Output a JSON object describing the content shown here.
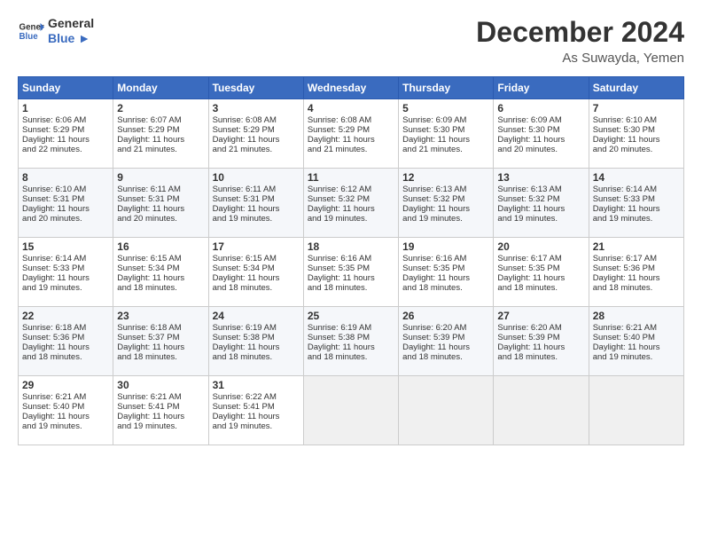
{
  "header": {
    "logo_line1": "General",
    "logo_line2": "Blue",
    "month": "December 2024",
    "location": "As Suwayda, Yemen"
  },
  "days_of_week": [
    "Sunday",
    "Monday",
    "Tuesday",
    "Wednesday",
    "Thursday",
    "Friday",
    "Saturday"
  ],
  "weeks": [
    [
      {
        "day": "1",
        "lines": [
          "Sunrise: 6:06 AM",
          "Sunset: 5:29 PM",
          "Daylight: 11 hours",
          "and 22 minutes."
        ]
      },
      {
        "day": "2",
        "lines": [
          "Sunrise: 6:07 AM",
          "Sunset: 5:29 PM",
          "Daylight: 11 hours",
          "and 21 minutes."
        ]
      },
      {
        "day": "3",
        "lines": [
          "Sunrise: 6:08 AM",
          "Sunset: 5:29 PM",
          "Daylight: 11 hours",
          "and 21 minutes."
        ]
      },
      {
        "day": "4",
        "lines": [
          "Sunrise: 6:08 AM",
          "Sunset: 5:29 PM",
          "Daylight: 11 hours",
          "and 21 minutes."
        ]
      },
      {
        "day": "5",
        "lines": [
          "Sunrise: 6:09 AM",
          "Sunset: 5:30 PM",
          "Daylight: 11 hours",
          "and 21 minutes."
        ]
      },
      {
        "day": "6",
        "lines": [
          "Sunrise: 6:09 AM",
          "Sunset: 5:30 PM",
          "Daylight: 11 hours",
          "and 20 minutes."
        ]
      },
      {
        "day": "7",
        "lines": [
          "Sunrise: 6:10 AM",
          "Sunset: 5:30 PM",
          "Daylight: 11 hours",
          "and 20 minutes."
        ]
      }
    ],
    [
      {
        "day": "8",
        "lines": [
          "Sunrise: 6:10 AM",
          "Sunset: 5:31 PM",
          "Daylight: 11 hours",
          "and 20 minutes."
        ]
      },
      {
        "day": "9",
        "lines": [
          "Sunrise: 6:11 AM",
          "Sunset: 5:31 PM",
          "Daylight: 11 hours",
          "and 20 minutes."
        ]
      },
      {
        "day": "10",
        "lines": [
          "Sunrise: 6:11 AM",
          "Sunset: 5:31 PM",
          "Daylight: 11 hours",
          "and 19 minutes."
        ]
      },
      {
        "day": "11",
        "lines": [
          "Sunrise: 6:12 AM",
          "Sunset: 5:32 PM",
          "Daylight: 11 hours",
          "and 19 minutes."
        ]
      },
      {
        "day": "12",
        "lines": [
          "Sunrise: 6:13 AM",
          "Sunset: 5:32 PM",
          "Daylight: 11 hours",
          "and 19 minutes."
        ]
      },
      {
        "day": "13",
        "lines": [
          "Sunrise: 6:13 AM",
          "Sunset: 5:32 PM",
          "Daylight: 11 hours",
          "and 19 minutes."
        ]
      },
      {
        "day": "14",
        "lines": [
          "Sunrise: 6:14 AM",
          "Sunset: 5:33 PM",
          "Daylight: 11 hours",
          "and 19 minutes."
        ]
      }
    ],
    [
      {
        "day": "15",
        "lines": [
          "Sunrise: 6:14 AM",
          "Sunset: 5:33 PM",
          "Daylight: 11 hours",
          "and 19 minutes."
        ]
      },
      {
        "day": "16",
        "lines": [
          "Sunrise: 6:15 AM",
          "Sunset: 5:34 PM",
          "Daylight: 11 hours",
          "and 18 minutes."
        ]
      },
      {
        "day": "17",
        "lines": [
          "Sunrise: 6:15 AM",
          "Sunset: 5:34 PM",
          "Daylight: 11 hours",
          "and 18 minutes."
        ]
      },
      {
        "day": "18",
        "lines": [
          "Sunrise: 6:16 AM",
          "Sunset: 5:35 PM",
          "Daylight: 11 hours",
          "and 18 minutes."
        ]
      },
      {
        "day": "19",
        "lines": [
          "Sunrise: 6:16 AM",
          "Sunset: 5:35 PM",
          "Daylight: 11 hours",
          "and 18 minutes."
        ]
      },
      {
        "day": "20",
        "lines": [
          "Sunrise: 6:17 AM",
          "Sunset: 5:35 PM",
          "Daylight: 11 hours",
          "and 18 minutes."
        ]
      },
      {
        "day": "21",
        "lines": [
          "Sunrise: 6:17 AM",
          "Sunset: 5:36 PM",
          "Daylight: 11 hours",
          "and 18 minutes."
        ]
      }
    ],
    [
      {
        "day": "22",
        "lines": [
          "Sunrise: 6:18 AM",
          "Sunset: 5:36 PM",
          "Daylight: 11 hours",
          "and 18 minutes."
        ]
      },
      {
        "day": "23",
        "lines": [
          "Sunrise: 6:18 AM",
          "Sunset: 5:37 PM",
          "Daylight: 11 hours",
          "and 18 minutes."
        ]
      },
      {
        "day": "24",
        "lines": [
          "Sunrise: 6:19 AM",
          "Sunset: 5:38 PM",
          "Daylight: 11 hours",
          "and 18 minutes."
        ]
      },
      {
        "day": "25",
        "lines": [
          "Sunrise: 6:19 AM",
          "Sunset: 5:38 PM",
          "Daylight: 11 hours",
          "and 18 minutes."
        ]
      },
      {
        "day": "26",
        "lines": [
          "Sunrise: 6:20 AM",
          "Sunset: 5:39 PM",
          "Daylight: 11 hours",
          "and 18 minutes."
        ]
      },
      {
        "day": "27",
        "lines": [
          "Sunrise: 6:20 AM",
          "Sunset: 5:39 PM",
          "Daylight: 11 hours",
          "and 18 minutes."
        ]
      },
      {
        "day": "28",
        "lines": [
          "Sunrise: 6:21 AM",
          "Sunset: 5:40 PM",
          "Daylight: 11 hours",
          "and 19 minutes."
        ]
      }
    ],
    [
      {
        "day": "29",
        "lines": [
          "Sunrise: 6:21 AM",
          "Sunset: 5:40 PM",
          "Daylight: 11 hours",
          "and 19 minutes."
        ]
      },
      {
        "day": "30",
        "lines": [
          "Sunrise: 6:21 AM",
          "Sunset: 5:41 PM",
          "Daylight: 11 hours",
          "and 19 minutes."
        ]
      },
      {
        "day": "31",
        "lines": [
          "Sunrise: 6:22 AM",
          "Sunset: 5:41 PM",
          "Daylight: 11 hours",
          "and 19 minutes."
        ]
      },
      null,
      null,
      null,
      null
    ]
  ]
}
